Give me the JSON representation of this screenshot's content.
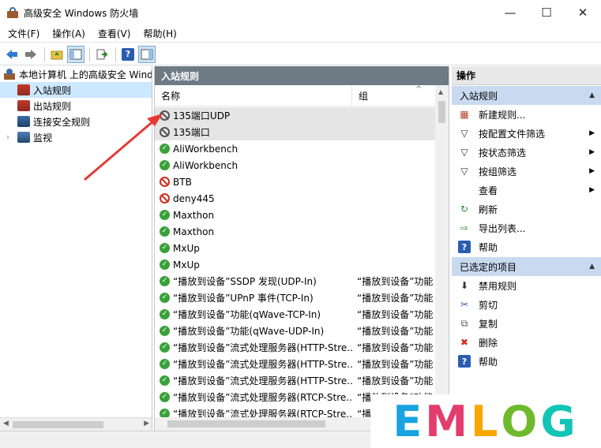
{
  "window": {
    "title": "高级安全 Windows 防火墙",
    "minimize": "—",
    "maximize": "☐",
    "close": "✕"
  },
  "menu": [
    "文件(F)",
    "操作(A)",
    "查看(V)",
    "帮助(H)"
  ],
  "tree": {
    "root": "本地计算机 上的高级安全 Windows 防火墙",
    "items": [
      {
        "label": "入站规则",
        "selected": true
      },
      {
        "label": "出站规则",
        "selected": false
      },
      {
        "label": "连接安全规则",
        "selected": false
      },
      {
        "label": "监视",
        "selected": false
      }
    ]
  },
  "main": {
    "header": "入站规则",
    "columns": {
      "name": "名称",
      "group": "组"
    },
    "rows": [
      {
        "name": "135端口UDP",
        "group": "",
        "status": "blocked-gray",
        "selected": true
      },
      {
        "name": "135端口",
        "group": "",
        "status": "blocked-gray",
        "selected": true
      },
      {
        "name": "AliWorkbench",
        "group": "",
        "status": "allowed"
      },
      {
        "name": "AliWorkbench",
        "group": "",
        "status": "allowed"
      },
      {
        "name": "BTB",
        "group": "",
        "status": "blocked"
      },
      {
        "name": "deny445",
        "group": "",
        "status": "blocked"
      },
      {
        "name": "Maxthon",
        "group": "",
        "status": "allowed"
      },
      {
        "name": "Maxthon",
        "group": "",
        "status": "allowed"
      },
      {
        "name": "MxUp",
        "group": "",
        "status": "allowed"
      },
      {
        "name": "MxUp",
        "group": "",
        "status": "allowed"
      },
      {
        "name": "“播放到设备”SSDP 发现(UDP-In)",
        "group": "“播放到设备”功能",
        "status": "allowed"
      },
      {
        "name": "“播放到设备”UPnP 事件(TCP-In)",
        "group": "“播放到设备”功能",
        "status": "allowed"
      },
      {
        "name": "“播放到设备”功能(qWave-TCP-In)",
        "group": "“播放到设备”功能",
        "status": "allowed"
      },
      {
        "name": "“播放到设备”功能(qWave-UDP-In)",
        "group": "“播放到设备”功能",
        "status": "allowed"
      },
      {
        "name": "“播放到设备”流式处理服务器(HTTP-Stre...",
        "group": "“播放到设备”功能",
        "status": "allowed"
      },
      {
        "name": "“播放到设备”流式处理服务器(HTTP-Stre...",
        "group": "“播放到设备”功能",
        "status": "allowed"
      },
      {
        "name": "“播放到设备”流式处理服务器(HTTP-Stre...",
        "group": "“播放到设备”功能",
        "status": "allowed"
      },
      {
        "name": "“播放到设备”流式处理服务器(RTCP-Stre...",
        "group": "“播放到设备”功能",
        "status": "allowed"
      },
      {
        "name": "“播放到设备”流式处理服务器(RTCP-Stre...",
        "group": "“播放到设备”功能",
        "status": "allowed"
      }
    ]
  },
  "actions": {
    "header": "操作",
    "section1": {
      "title": "入站规则",
      "items": [
        {
          "label": "新建规则...",
          "icon": "new-rule-icon",
          "submenu": false
        },
        {
          "label": "按配置文件筛选",
          "icon": "filter-icon",
          "submenu": true
        },
        {
          "label": "按状态筛选",
          "icon": "filter-icon",
          "submenu": true
        },
        {
          "label": "按组筛选",
          "icon": "filter-icon",
          "submenu": true
        },
        {
          "label": "查看",
          "icon": "",
          "submenu": true
        },
        {
          "label": "刷新",
          "icon": "refresh-icon",
          "submenu": false
        },
        {
          "label": "导出列表...",
          "icon": "export-icon",
          "submenu": false
        },
        {
          "label": "帮助",
          "icon": "help-icon",
          "submenu": false
        }
      ]
    },
    "section2": {
      "title": "已选定的项目",
      "items": [
        {
          "label": "禁用规则",
          "icon": "disable-icon",
          "submenu": false
        },
        {
          "label": "剪切",
          "icon": "cut-icon",
          "submenu": false
        },
        {
          "label": "复制",
          "icon": "copy-icon",
          "submenu": false
        },
        {
          "label": "删除",
          "icon": "delete-icon",
          "submenu": false
        },
        {
          "label": "帮助",
          "icon": "help-icon",
          "submenu": false
        }
      ]
    }
  },
  "watermark": {
    "e": "E",
    "m": "M",
    "l": "L",
    "o": "O",
    "g": "G"
  },
  "colors": {
    "accent": "#c9daf0",
    "pane_header": "#6e7a84",
    "annotation_arrow": "#e53935"
  }
}
